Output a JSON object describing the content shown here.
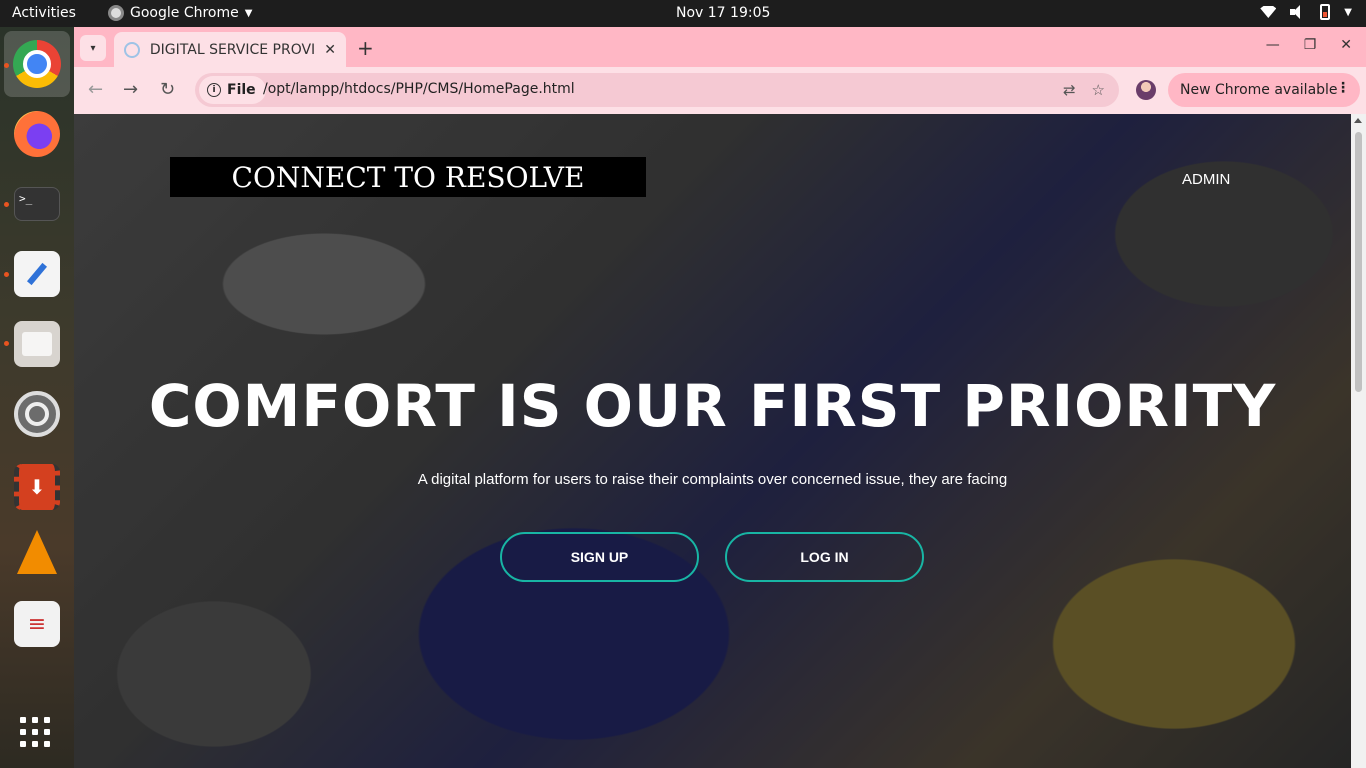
{
  "system": {
    "activities": "Activities",
    "app_name": "Google Chrome",
    "clock": "Nov 17  19:05"
  },
  "dock": {
    "items": [
      "Google Chrome",
      "Firefox",
      "Terminal",
      "Text Editor",
      "Files",
      "Settings",
      "Downloader",
      "VLC",
      "Document Viewer",
      "Show Applications"
    ]
  },
  "browser": {
    "tab_title": "DIGITAL SERVICE PROVII",
    "address_scheme": "File",
    "url": "/opt/lampp/htdocs/PHP/CMS/HomePage.html",
    "update_label": "New Chrome available",
    "theme_color": "#ffb7c5"
  },
  "page": {
    "brand": "CONNECT TO RESOLVE",
    "admin_link": "ADMIN",
    "hero_title": "COMFORT IS OUR FIRST PRIORITY",
    "hero_subtitle": "A digital platform for users to raise their complaints over concerned issue, they are facing",
    "signup_label": "SIGN UP",
    "login_label": "LOG IN",
    "accent_color": "#18b5a4"
  }
}
